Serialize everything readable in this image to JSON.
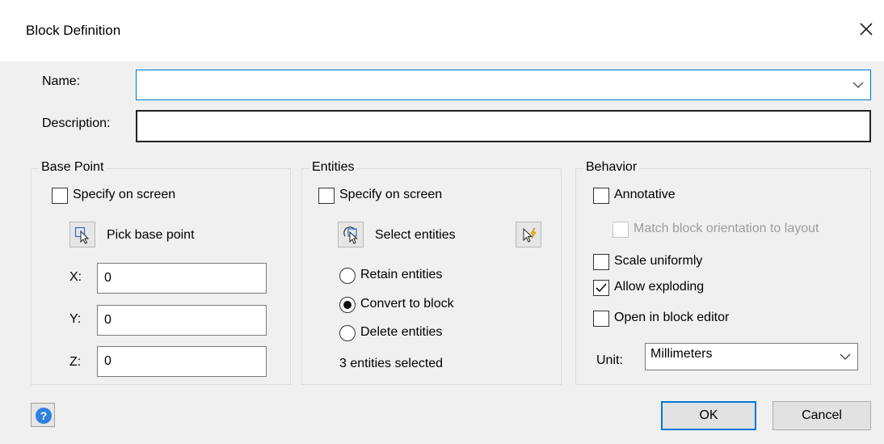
{
  "window": {
    "title": "Block Definition",
    "close_icon": "close-icon"
  },
  "name_field": {
    "label": "Name:",
    "value": ""
  },
  "description_field": {
    "label": "Description:",
    "value": ""
  },
  "base_point": {
    "title": "Base Point",
    "specify_on_screen": "Specify on screen",
    "pick_label": "Pick base point",
    "x_label": "X:",
    "x_value": "0",
    "y_label": "Y:",
    "y_value": "0",
    "z_label": "Z:",
    "z_value": "0"
  },
  "entities": {
    "title": "Entities",
    "specify_on_screen": "Specify on screen",
    "select_label": "Select entities",
    "retain": "Retain entities",
    "convert": "Convert to block",
    "delete": "Delete entities",
    "selected_selection": "convert",
    "count_text": "3 entities selected"
  },
  "behavior": {
    "title": "Behavior",
    "annotative": "Annotative",
    "match_orientation": "Match block orientation to layout",
    "scale_uniformly": "Scale uniformly",
    "allow_exploding": "Allow exploding",
    "allow_exploding_checked": true,
    "open_in_editor": "Open in block editor",
    "unit_label": "Unit:",
    "unit_value": "Millimeters"
  },
  "footer": {
    "ok": "OK",
    "cancel": "Cancel",
    "help_glyph": "?"
  }
}
